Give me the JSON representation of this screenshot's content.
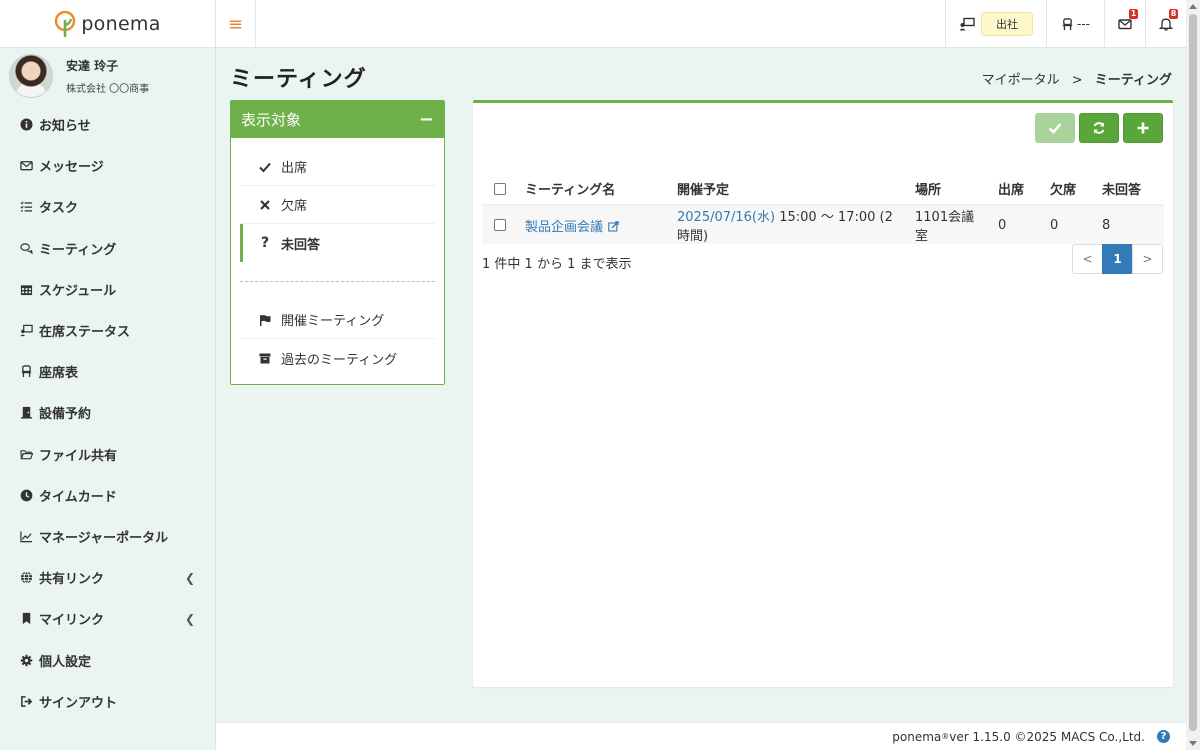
{
  "app": {
    "name": "ponema",
    "brand_color": "#6fb04a",
    "logo_color": "#f08a24"
  },
  "user": {
    "name": "安達 玲子",
    "company": "株式会社 〇〇商事"
  },
  "sidebar": {
    "items": [
      {
        "label": "お知らせ",
        "icon": "info-icon"
      },
      {
        "label": "メッセージ",
        "icon": "envelope-icon"
      },
      {
        "label": "タスク",
        "icon": "tasks-icon"
      },
      {
        "label": "ミーティング",
        "icon": "chat-icon"
      },
      {
        "label": "スケジュール",
        "icon": "calendar-icon"
      },
      {
        "label": "在席ステータス",
        "icon": "presence-icon"
      },
      {
        "label": "座席表",
        "icon": "chair-icon"
      },
      {
        "label": "設備予約",
        "icon": "door-icon"
      },
      {
        "label": "ファイル共有",
        "icon": "folder-icon"
      },
      {
        "label": "タイムカード",
        "icon": "clock-icon"
      },
      {
        "label": "マネージャーポータル",
        "icon": "chart-icon"
      },
      {
        "label": "共有リンク",
        "icon": "globe-icon"
      },
      {
        "label": "マイリンク",
        "icon": "bookmark-icon"
      },
      {
        "label": "個人設定",
        "icon": "gear-icon"
      },
      {
        "label": "サインアウト",
        "icon": "signout-icon"
      }
    ]
  },
  "topbar": {
    "status_label": "出社",
    "seat_label": "---",
    "message_badge": "1",
    "notification_badge": "8"
  },
  "page": {
    "title": "ミーティング",
    "breadcrumb": {
      "parent": "マイポータル",
      "separator": ">",
      "current": "ミーティング"
    }
  },
  "filter": {
    "title": "表示対象",
    "collapse_symbol": "−",
    "items": [
      {
        "label": "出席",
        "icon": "check-icon"
      },
      {
        "label": "欠席",
        "icon": "x-icon"
      },
      {
        "label": "未回答",
        "icon": "question-icon",
        "active": true
      }
    ],
    "items2": [
      {
        "label": "開催ミーティング",
        "icon": "flag-icon"
      },
      {
        "label": "過去のミーティング",
        "icon": "archive-icon"
      }
    ]
  },
  "table": {
    "headers": {
      "name": "ミーティング名",
      "schedule": "開催予定",
      "place": "場所",
      "attend": "出席",
      "absent": "欠席",
      "noreply": "未回答"
    },
    "rows": [
      {
        "name": "製品企画会議",
        "date": "2025/07/16(水)",
        "time": "15:00 〜 17:00 (2時間)",
        "place": "1101会議室",
        "attend": "0",
        "absent": "0",
        "noreply": "8"
      }
    ]
  },
  "pagination": {
    "summary": "1 件中 1 から 1 まで表示",
    "prev": "<",
    "current": "1",
    "next": ">"
  },
  "footer": {
    "brand": "ponema",
    "reg": "®",
    "version": " ver 1.15.0 ©2025 MACS Co.,Ltd.",
    "help": "?"
  }
}
